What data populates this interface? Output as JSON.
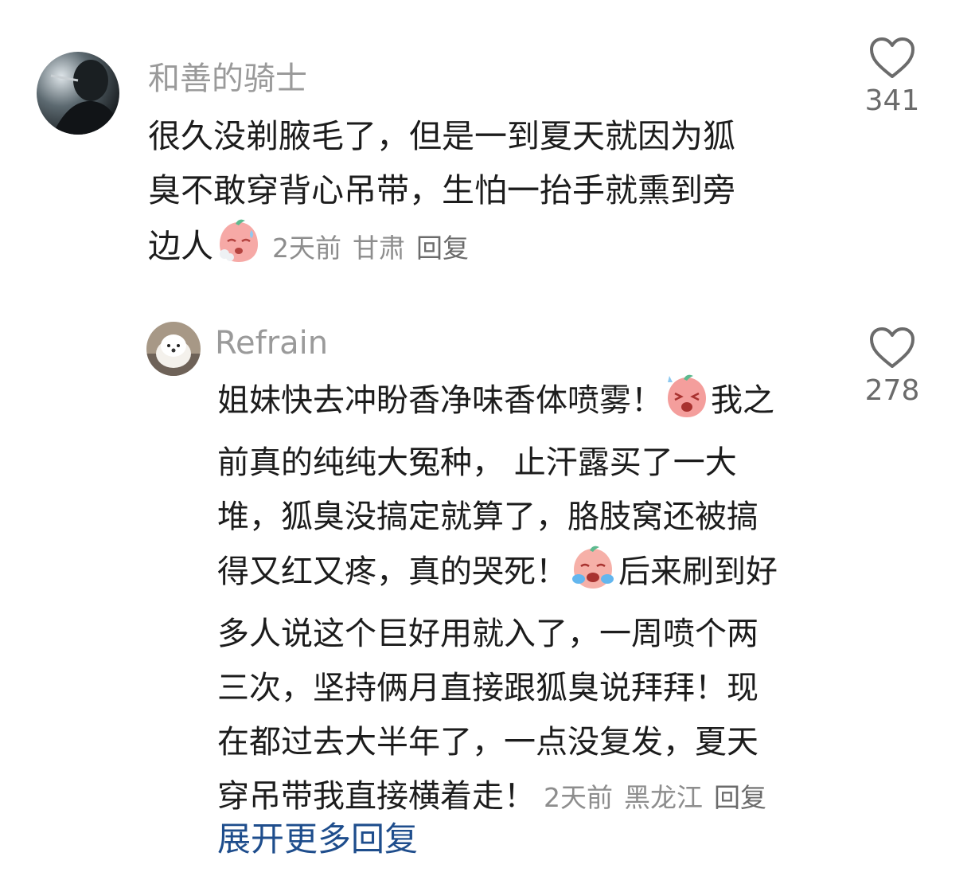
{
  "comment1": {
    "username": "和善的骑士",
    "lines": [
      "很久没剃腋毛了，但是一到夏天就因为狐",
      "臭不敢穿背心吊带，生怕一抬手就熏到旁",
      "边人"
    ],
    "time": "2天前",
    "location": "甘肃",
    "reply": "回复",
    "likes": "341"
  },
  "comment2": {
    "username": "Refrain",
    "line1_before": "姐妹快去冲盼香净味香体喷雾！",
    "line1_after": "我之",
    "line2": "前真的纯纯大冤种， 止汗露买了一大",
    "line3": "堆，狐臭没搞定就算了，胳肢窝还被搞",
    "line4_before": "得又红又疼，真的哭死！",
    "line4_after": "后来刷到好",
    "line5": "多人说这个巨好用就入了，一周喷个两",
    "line6": "三次，坚持俩月直接跟狐臭说拜拜！现",
    "line7": "在都过去大半年了，一点没复发，夏天",
    "line8": "穿吊带我直接横着走！",
    "time": "2天前",
    "location": "黑龙江",
    "reply": "回复",
    "likes": "278"
  },
  "expand_replies": "展开更多回复",
  "colors": {
    "username": "#9a9a9a",
    "body": "#1c1c1c",
    "meta": "#8d8d8d",
    "link": "#1e4d8c",
    "heart": "#6b6b6b"
  },
  "icons": [
    "heart-outline-icon",
    "sweating-peach-emoji",
    "angry-peach-emoji",
    "crying-peach-emoji"
  ]
}
